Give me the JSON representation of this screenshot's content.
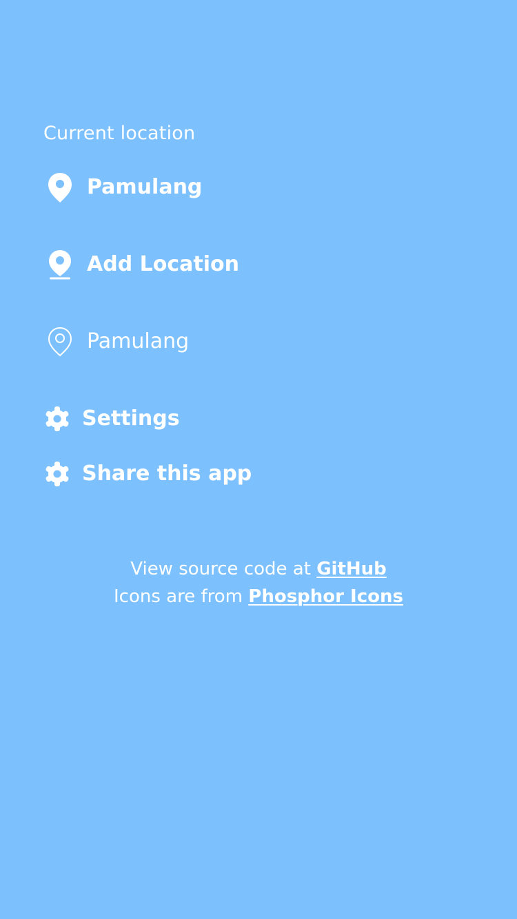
{
  "theme": {
    "background": "#7cc1fd",
    "foreground": "#ffffff"
  },
  "menu": {
    "current_location_heading": "Current location",
    "current_location": {
      "label": "Pamulang",
      "icon": "map-pin-fill-icon"
    },
    "add_location": {
      "label": "Add Location",
      "icon": "map-pin-line-fill-icon"
    },
    "saved_locations": [
      {
        "label": "Pamulang",
        "icon": "map-pin-outline-icon"
      }
    ],
    "settings": {
      "label": "Settings",
      "icon": "gear-icon"
    },
    "share": {
      "label": "Share this app",
      "icon": "gear-icon"
    }
  },
  "footer": {
    "source_prefix": "View source code at ",
    "source_link": "GitHub",
    "icons_prefix": "Icons are from ",
    "icons_link": "Phosphor Icons"
  }
}
